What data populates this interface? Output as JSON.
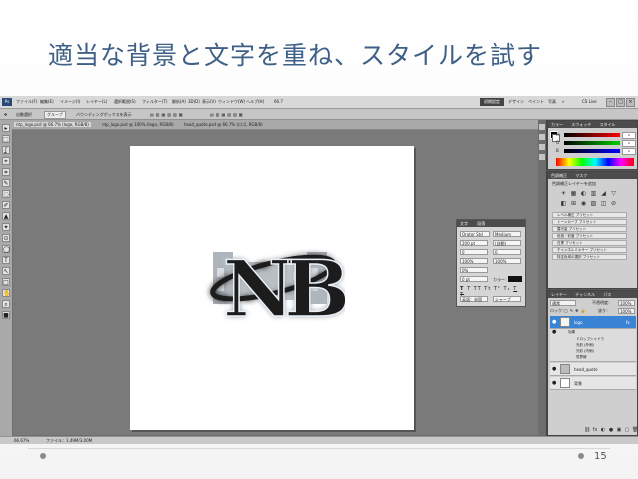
{
  "slide": {
    "title": "適当な背景と文字を重ね、スタイルを試す",
    "page_number": "15"
  },
  "menubar": {
    "logo": "Ps",
    "items": [
      "ファイル(F)",
      "編集(E)",
      "イメージ(I)",
      "レイヤー(L)",
      "選択範囲(S)",
      "フィルター(T)",
      "解析(A)",
      "3D(D)",
      "表示(V)",
      "ウィンドウ(W)",
      "ヘルプ(H)"
    ],
    "zoom": "66.7",
    "workspaces": [
      "初期設定",
      "デザイン",
      "ペイント",
      "写真",
      "»"
    ],
    "cslive": "CS Live"
  },
  "optionsbar": {
    "auto_select": "自動選択",
    "group": "グループ",
    "transform": "バウンディングボックスを表示"
  },
  "tabs": [
    "ntp_logo.psd @ 66.7% (logo, RGB/8)",
    "ntp_logo.psd @ 100% (logo, RGB/8)",
    "head_quote.psd @ 66.7% (ロゴ, RGB/8)"
  ],
  "status": {
    "zoom": "66.67%",
    "file_info": "ファイル：1.49M/3.00M"
  },
  "character_panel": {
    "tabs": [
      "文字",
      "段落"
    ],
    "font_family": "Orator Std",
    "font_style": "Medium",
    "font_size": "200 pt",
    "leading": "(自動)",
    "kerning": "0",
    "tracking": "0",
    "scale_v": "100%",
    "scale_h": "100%",
    "tsume": "0%",
    "baseline": "0 pt",
    "color_label": "カラー：",
    "language": "英語：米国",
    "antialias": "シャープ",
    "color": "#111111"
  },
  "color_panel": {
    "tabs": [
      "カラー",
      "スウォッチ",
      "スタイル"
    ],
    "channels": [
      {
        "label": "R",
        "value": "0",
        "gradient": "linear-gradient(90deg,#000,#f00)"
      },
      {
        "label": "G",
        "value": "0",
        "gradient": "linear-gradient(90deg,#000,#0c0)"
      },
      {
        "label": "B",
        "value": "0",
        "gradient": "linear-gradient(90deg,#000,#00f)"
      }
    ]
  },
  "adjustments_panel": {
    "tabs": [
      "色調補正",
      "マスク"
    ],
    "heading": "色調補正レイヤーを追加",
    "icons": [
      "☀",
      "▦",
      "◐",
      "▥",
      "◢",
      "▽",
      "◧",
      "⊞",
      "◉",
      "▨",
      "◫",
      "⊘"
    ],
    "presets": [
      "レベル補正 プリセット",
      "トーンカーブ プリセット",
      "露光量 プリセット",
      "色相・彩度 プリセット",
      "白黒 プリセット",
      "チャンネルミキサー プリセット",
      "特定色域の選択 プリセット"
    ]
  },
  "layers_panel": {
    "tabs": [
      "レイヤー",
      "チャンネル",
      "パス"
    ],
    "blend_mode": "通常",
    "opacity_label": "不透明度：",
    "opacity": "100%",
    "lock_label": "ロック：",
    "fill_label": "塗り：",
    "fill": "100%",
    "layers": [
      {
        "name": "logo",
        "fx": "fx",
        "selected": true,
        "effects_label": "効果",
        "effects": [
          "ドロップシャドウ",
          "光彩 (外側)",
          "光彩 (内側)",
          "境界線"
        ]
      },
      {
        "name": "head_quote",
        "selected": false
      },
      {
        "name": "背景",
        "selected": false
      }
    ],
    "bottom_icons": [
      "⛓",
      "fx",
      "◐",
      "●",
      "▣",
      "▢",
      "🗑"
    ]
  },
  "toolbox": {
    "tools": [
      "▸",
      "⬚",
      "ʆ",
      "⌖",
      "⌗",
      "✎",
      "◌",
      "✐",
      "▲",
      "✦",
      "⊙",
      "◯",
      "T",
      "↖",
      "□",
      "✋",
      "⌕",
      "■"
    ]
  },
  "document": {
    "logo_text": "NB"
  }
}
